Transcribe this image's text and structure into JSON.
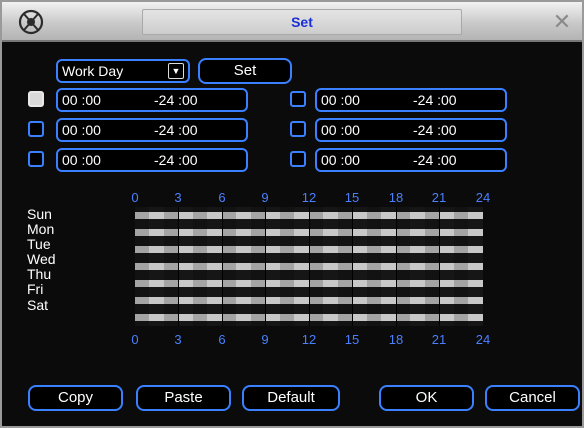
{
  "window": {
    "title": "Set"
  },
  "top_row": {
    "period_value": "Work Day",
    "set_button": "Set"
  },
  "periods_left": [
    {
      "start": "00 :00",
      "end": "-24 :00",
      "checked": true
    },
    {
      "start": "00 :00",
      "end": "-24 :00",
      "checked": false
    },
    {
      "start": "00 :00",
      "end": "-24 :00",
      "checked": false
    }
  ],
  "periods_right": [
    {
      "start": "00 :00",
      "end": "-24 :00",
      "checked": false
    },
    {
      "start": "00 :00",
      "end": "-24 :00",
      "checked": false
    },
    {
      "start": "00 :00",
      "end": "-24 :00",
      "checked": false
    }
  ],
  "schedule": {
    "days": [
      "Sun",
      "Mon",
      "Tue",
      "Wed",
      "Thu",
      "Fri",
      "Sat"
    ],
    "hours_top": [
      "0",
      "3",
      "6",
      "9",
      "12",
      "15",
      "18",
      "21",
      "24"
    ],
    "hours_bottom": [
      "0",
      "3",
      "6",
      "9",
      "12",
      "15",
      "18",
      "21",
      "24"
    ]
  },
  "buttons": {
    "copy": "Copy",
    "paste": "Paste",
    "default": "Default",
    "ok": "OK",
    "cancel": "Cancel"
  },
  "colors": {
    "accent": "#3a80ff",
    "title_text": "#1a2fd6",
    "bar": "#c8c8c8"
  },
  "icons": {
    "logo": "logo-icon",
    "close": "close-icon",
    "dropdown": "chevron-down-icon"
  }
}
